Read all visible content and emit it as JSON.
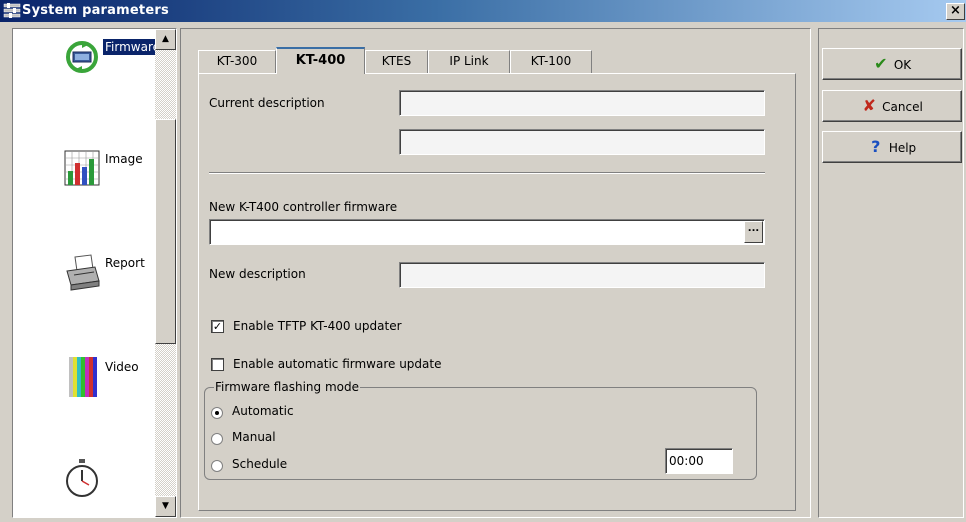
{
  "window": {
    "title": "System parameters",
    "close_label": "×"
  },
  "sidebar": {
    "items": [
      {
        "label": "Firmware",
        "icon": "firmware-icon",
        "selected": true
      },
      {
        "label": "Image",
        "icon": "chart-icon",
        "selected": false
      },
      {
        "label": "Report",
        "icon": "printer-icon",
        "selected": false
      },
      {
        "label": "Video",
        "icon": "color-bars-icon",
        "selected": false
      },
      {
        "label": "Timer",
        "icon": "stopwatch-icon",
        "selected": false
      }
    ]
  },
  "tabs": [
    "KT-300",
    "KT-400",
    "KTES",
    "IP Link",
    "KT-100"
  ],
  "active_tab": "KT-400",
  "form": {
    "current_description_label": "Current description",
    "current_description_value1": "",
    "current_description_value2": "",
    "new_firmware_label": "New K-T400 controller firmware",
    "new_firmware_value": "",
    "browse_label": "...",
    "new_description_label": "New description",
    "new_description_value": "",
    "enable_tftp_label": "Enable TFTP KT-400 updater",
    "enable_tftp_checked": true,
    "enable_auto_label": "Enable automatic firmware update",
    "enable_auto_checked": false,
    "check_mark": "✓",
    "flashing_group_title": "Firmware flashing mode",
    "mode_automatic": "Automatic",
    "mode_manual": "Manual",
    "mode_schedule": "Schedule",
    "selected_mode": "Automatic",
    "schedule_time": "00:00"
  },
  "buttons": {
    "ok": "OK",
    "cancel": "Cancel",
    "help": "Help"
  },
  "colors": {
    "title_start": "#0a246a",
    "title_end": "#a6caf0",
    "face": "#d4d0c8",
    "selection": "#0a246a",
    "ok_check": "#2a8a1a",
    "cancel_x": "#c0281c",
    "help_q": "#1a4fc0"
  }
}
